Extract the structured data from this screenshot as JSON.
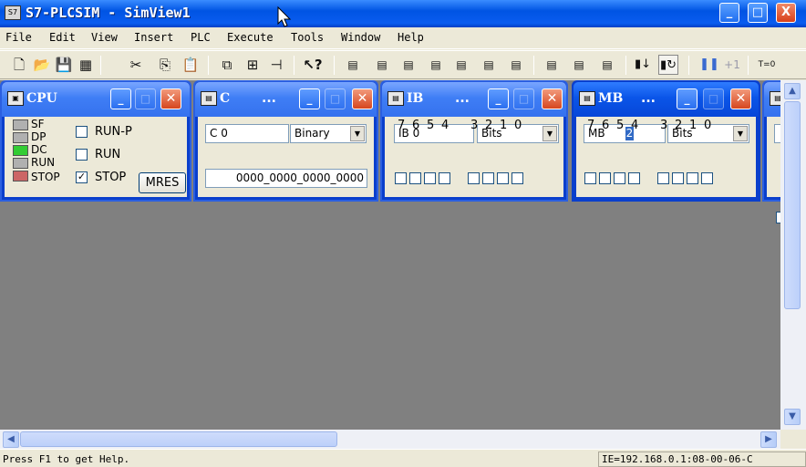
{
  "app": {
    "title": "S7-PLCSIM - SimView1",
    "icon_text": "S7",
    "minimize": "_",
    "maximize": "□",
    "close": "X"
  },
  "menu": [
    "File",
    "Edit",
    "View",
    "Insert",
    "PLC",
    "Execute",
    "Tools",
    "Window",
    "Help"
  ],
  "toolbar": {
    "t0_label": "T=0"
  },
  "cpu": {
    "title": "CPU",
    "leds": [
      {
        "label": "SF",
        "color": "#b0b0b0"
      },
      {
        "label": "DP",
        "color": "#b0b0b0"
      },
      {
        "label": "DC",
        "color": "#33cc33"
      },
      {
        "label": "RUN",
        "color": "#b0b0b0"
      },
      {
        "label": "STOP",
        "color": "#cc6666"
      }
    ],
    "modes": [
      {
        "label": "RUN-P",
        "checked": false
      },
      {
        "label": "RUN",
        "checked": false
      },
      {
        "label": "STOP",
        "checked": true
      }
    ],
    "mres_label": "MRES"
  },
  "counter_window": {
    "title": "C",
    "dots": "...",
    "address": "C    0",
    "format": "Binary",
    "value": "0000_0000_0000_0000"
  },
  "ib_window": {
    "title": "IB",
    "dots": "...",
    "address": "IB    0",
    "format": "Bits",
    "bits": [
      "7",
      "6",
      "5",
      "4",
      "3",
      "2",
      "1",
      "0"
    ]
  },
  "mb_window": {
    "title": "MB",
    "dots": "...",
    "address_prefix": "MB",
    "address_value": "2",
    "format": "Bits",
    "bits": [
      "7",
      "6",
      "5",
      "4",
      "3",
      "2",
      "1",
      "0"
    ]
  },
  "status": {
    "help_text": "Press F1 to get Help.",
    "address": "IE=192.168.0.1:08-00-06-C"
  },
  "colors": {
    "titlebar": "#0054e3",
    "active_caption": "#0a55e8",
    "inactive_caption": "#3f7ef5",
    "workspace": "#808080"
  }
}
